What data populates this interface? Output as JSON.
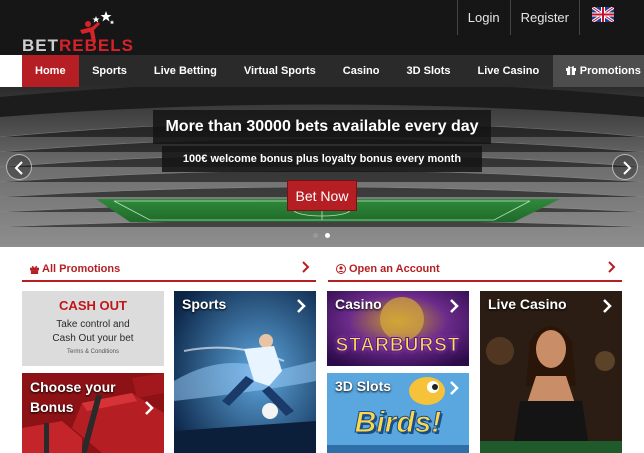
{
  "header": {
    "logo": {
      "part1": "BET",
      "part2": "REBELS"
    },
    "links": {
      "login": "Login",
      "register": "Register"
    }
  },
  "nav": {
    "items": [
      "Home",
      "Sports",
      "Live Betting",
      "Virtual Sports",
      "Casino",
      "3D Slots",
      "Live Casino"
    ],
    "promotions": "Promotions",
    "active": "Home"
  },
  "hero": {
    "title": "More than 30000 bets available every day",
    "subtitle": "100€ welcome bonus plus loyalty bonus every month",
    "cta": "Bet Now",
    "slide_count": 2,
    "active_slide": 2
  },
  "sections": {
    "promotions": "All Promotions",
    "account": "Open an Account"
  },
  "cashout": {
    "title": "CASH OUT",
    "line1": "Take control and",
    "line2": "Cash Out your bet",
    "terms": "Terms & Conditions"
  },
  "tiles": {
    "choose_bonus_1": "Choose your",
    "choose_bonus_2": "Bonus",
    "sports": "Sports",
    "casino": "Casino",
    "casino_game": "STARBURST",
    "slots": "3D Slots",
    "slots_game": "Birds!",
    "live_casino": "Live Casino"
  },
  "colors": {
    "brand_red": "#b51f23",
    "dark": "#161616",
    "nav": "#2a2a2a"
  }
}
